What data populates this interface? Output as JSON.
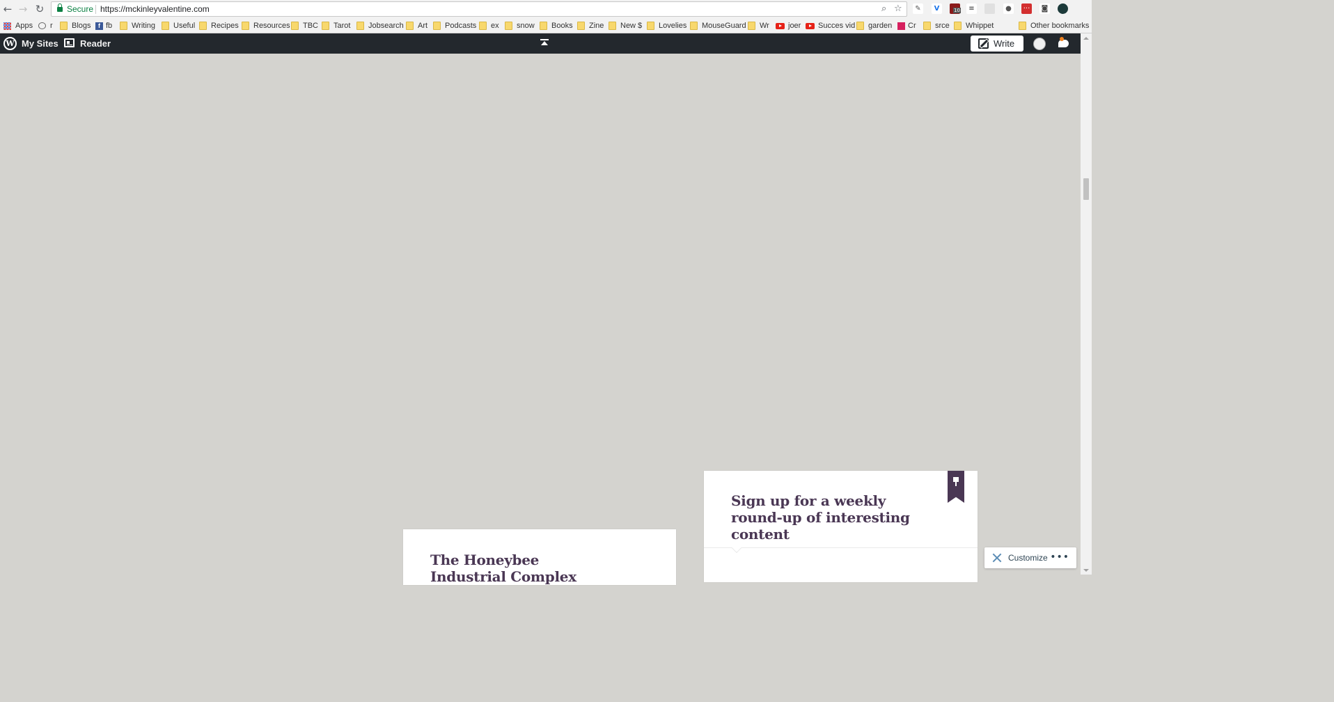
{
  "browser": {
    "secure_label": "Secure",
    "url": "https://mckinleyvalentine.com",
    "extension_badge": "10"
  },
  "bookmarks": [
    {
      "label": "Apps",
      "icon": "apps-grid-icon"
    },
    {
      "label": "r",
      "icon": "reddit-icon"
    },
    {
      "label": "Blogs",
      "icon": "folder-icon"
    },
    {
      "label": "fb",
      "icon": "facebook-icon"
    },
    {
      "label": "Writing",
      "icon": "folder-icon"
    },
    {
      "label": "Useful",
      "icon": "folder-icon"
    },
    {
      "label": "Recipes",
      "icon": "folder-icon"
    },
    {
      "label": "Resources",
      "icon": "folder-icon"
    },
    {
      "label": "TBC",
      "icon": "folder-icon"
    },
    {
      "label": "Tarot",
      "icon": "folder-icon"
    },
    {
      "label": "Jobsearch",
      "icon": "folder-icon"
    },
    {
      "label": "Art",
      "icon": "folder-icon"
    },
    {
      "label": "Podcasts",
      "icon": "folder-icon"
    },
    {
      "label": "ex",
      "icon": "folder-icon"
    },
    {
      "label": "snow",
      "icon": "folder-icon"
    },
    {
      "label": "Books",
      "icon": "folder-icon"
    },
    {
      "label": "Zine",
      "icon": "folder-icon"
    },
    {
      "label": "New $",
      "icon": "folder-icon"
    },
    {
      "label": "Lovelies",
      "icon": "folder-icon"
    },
    {
      "label": "MouseGuard",
      "icon": "folder-icon"
    },
    {
      "label": "Wr",
      "icon": "folder-icon"
    },
    {
      "label": "joer",
      "icon": "youtube-icon"
    },
    {
      "label": "Succes vid",
      "icon": "youtube-icon"
    },
    {
      "label": "garden",
      "icon": "folder-icon"
    },
    {
      "label": "Cr",
      "icon": "cr-icon"
    },
    {
      "label": "srce",
      "icon": "folder-icon"
    },
    {
      "label": "Whippet",
      "icon": "folder-icon"
    }
  ],
  "other_bookmarks": "Other bookmarks",
  "wpbar": {
    "my_sites": "My Sites",
    "reader": "Reader",
    "write": "Write"
  },
  "cards": {
    "signup_title": "Sign up for a weekly round-up of interesting content",
    "honeybee_title": "The Honeybee Industrial Complex"
  },
  "customize": {
    "label": "Customize",
    "more": "•••"
  },
  "colors": {
    "background": "#d4d3cf",
    "admin_bar": "#23282d",
    "title": "#4a3754",
    "secure_green": "#0b8043"
  }
}
